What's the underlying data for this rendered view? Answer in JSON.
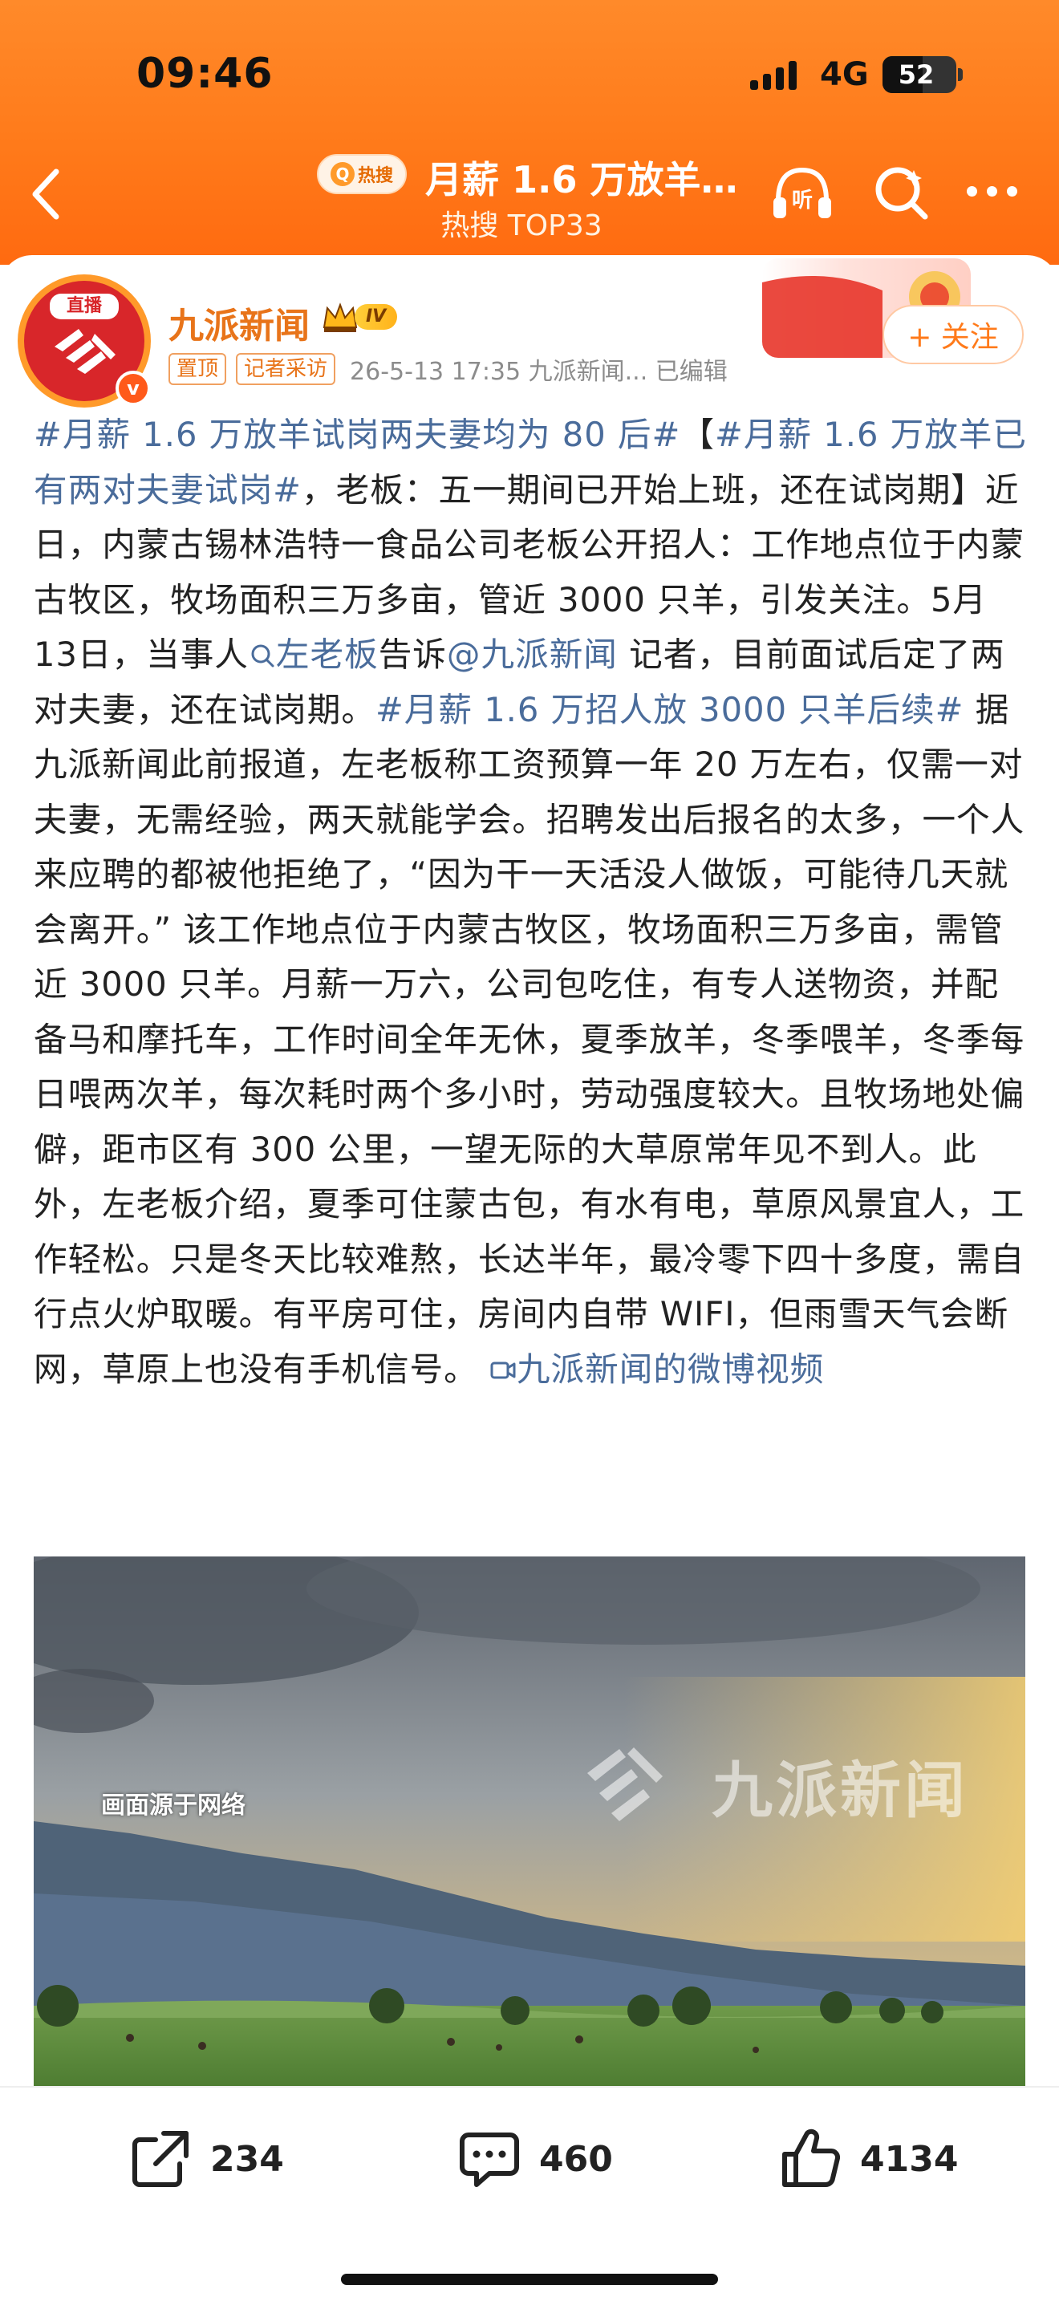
{
  "status_bar": {
    "time": "09:46",
    "network": "4G",
    "battery": "52"
  },
  "nav": {
    "hot_badge": "热搜",
    "title": "月薪 1.6 万放羊…",
    "subtitle": "热搜 TOP33"
  },
  "post": {
    "author": "九派新闻",
    "level": "IV",
    "avatar_live_label": "直播",
    "follow_label": "+ 关注",
    "tags": [
      "置顶",
      "记者采访"
    ],
    "meta": "26-5-13 17:35  九派新闻...  已编辑",
    "segments": [
      {
        "text": "#月薪 1.6 万放羊试岗两夫妻均为 80 后#",
        "link": true
      },
      {
        "text": "【",
        "link": false
      },
      {
        "text": "#月薪 1.6 万放羊已有两对夫妻试岗#",
        "link": true
      },
      {
        "text": "，老板：五一期间已开始上班，还在试岗期】近日，内蒙古锡林浩特一食品公司老板公开招人：工作地点位于内蒙古牧区，牧场面积三万多亩，管近 3000 只羊，引发关注。5月13日，当事人",
        "link": false
      },
      {
        "text": "左老板",
        "link": true,
        "icon": "search"
      },
      {
        "text": "告诉",
        "link": false
      },
      {
        "text": "@九派新闻",
        "link": true
      },
      {
        "text": " 记者，目前面试后定了两对夫妻，还在试岗期。",
        "link": false
      },
      {
        "text": "#月薪 1.6 万招人放 3000 只羊后续#",
        "link": true
      },
      {
        "text": " 据九派新闻此前报道，左老板称工资预算一年 20 万左右，仅需一对夫妻，无需经验，两天就能学会。招聘发出后报名的太多，一个人来应聘的都被他拒绝了，“因为干一天活没人做饭，可能待几天就会离开。” 该工作地点位于内蒙古牧区，牧场面积三万多亩，需管近 3000 只羊。月薪一万六，公司包吃住，有专人送物资，并配备马和摩托车，工作时间全年无休，夏季放羊，冬季喂羊，冬季每日喂两次羊，每次耗时两个多小时，劳动强度较大。且牧场地处偏僻，距市区有 300 公里，一望无际的大草原常年见不到人。此外，左老板介绍，夏季可住蒙古包，有水有电，草原风景宜人，工作轻松。只是冬天比较难熬，长达半年，最冷零下四十多度，需自行点火炉取暖。有平房可住，房间内自带 WIFI，但雨雪天气会断网，草原上也没有手机信号。 ",
        "link": false
      },
      {
        "text": "九派新闻的微博视频",
        "link": true,
        "icon": "video"
      }
    ],
    "video": {
      "caption": "画面源于网络",
      "watermark": "九派新闻"
    }
  },
  "actions": {
    "share": "234",
    "comment": "460",
    "like": "4134"
  },
  "colors": {
    "header_orange": "#ff7a1a",
    "link_blue": "#4a6c9b",
    "author_orange": "#e8741a"
  },
  "icons": [
    "back-icon",
    "listen-icon",
    "search-icon",
    "more-icon",
    "share-icon",
    "comment-icon",
    "like-icon",
    "crown-icon",
    "video-icon"
  ]
}
